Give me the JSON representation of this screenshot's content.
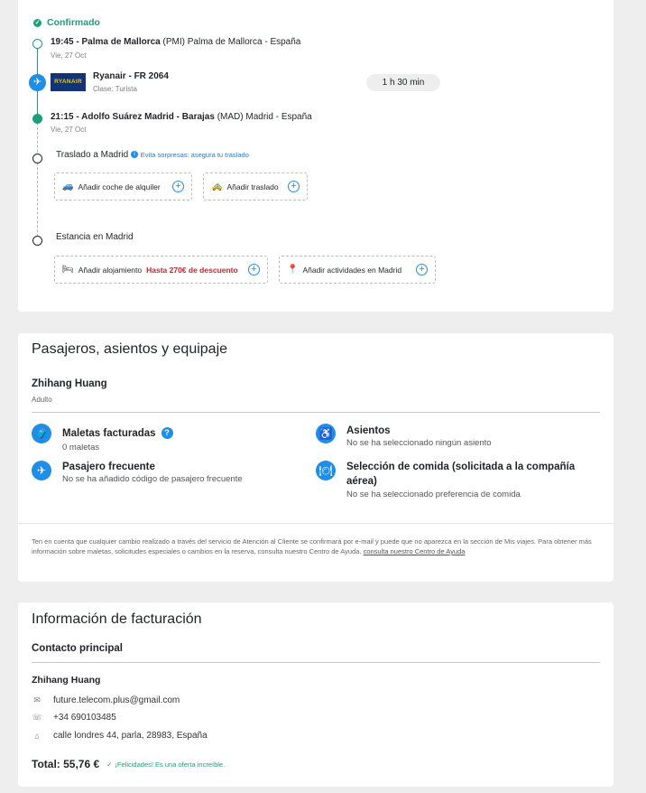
{
  "flight": {
    "status": "Confirmado",
    "departure": {
      "time": "19:45",
      "airport": "Palma de Mallorca",
      "code": "(PMI)",
      "city": "Palma de Mallorca - España",
      "date": "Vie, 27 Oct"
    },
    "airline_logo": "RYANAIR",
    "airline": "Ryanair - FR 2064",
    "class": "Clase: Turista",
    "duration": "1 h 30 min",
    "arrival": {
      "time": "21:15",
      "airport": "Adolfo Suárez Madrid - Barajas",
      "code": "(MAD)",
      "city": "Madrid - España",
      "date": "Vie, 27 Oct"
    },
    "transfer": {
      "title": "Traslado a Madrid",
      "hint": "Evita sorpresas: asegura tu traslado",
      "car": "Añadir coche de alquiler",
      "shuttle": "Añadir traslado"
    },
    "stay": {
      "title": "Estancia en Madrid",
      "lodging": "Añadir alojamiento",
      "discount": "Hasta 270€ de descuento",
      "activities": "Añadir actividades en Madrid"
    }
  },
  "passengers": {
    "heading": "Pasajeros, asientos y equipaje",
    "name": "Zhihang Huang",
    "type": "Adulto",
    "bags_title": "Maletas facturadas",
    "bags_value": "0 maletas",
    "seats_title": "Asientos",
    "seats_value": "No se ha seleccionado ningún asiento",
    "frequent_title": "Pasajero frecuente",
    "frequent_value": "No se ha añadido código de pasajero frecuente",
    "meal_title": "Selección de comida (solicitada a la compañía aérea)",
    "meal_value": "No se ha seleccionado preferencia de comida",
    "note": "Ten en cuenta que cualquier cambio realizado a través del servicio de Atención al Cliente se confirmará por e-mail y puede que no aparezca en la sección de Mis viajes. Para obtener más información sobre maletas, solicitudes especiales o cambios en la reserva, consulta nuestro Centro de Ayuda.",
    "note_link": "consulta nuestro Centro de Ayuda"
  },
  "billing": {
    "heading": "Información de facturación",
    "subheading": "Contacto principal",
    "name": "Zhihang Huang",
    "email": "future.telecom.plus@gmail.com",
    "phone": "+34 690103485",
    "address": "calle londres 44, parla, 28983, España",
    "total_label": "Total: 55,76 €",
    "deal": "¡Felicidades! Es una oferta increíble."
  },
  "icons": [
    "check-icon",
    "plane-icon",
    "car-icon",
    "taxi-icon",
    "bed-icon",
    "pin-icon",
    "plus-icon",
    "suitcase-icon",
    "seat-icon",
    "plane-icon",
    "meal-icon",
    "mail-icon",
    "phone-icon",
    "home-icon"
  ],
  "colors": {
    "accent": "#1f8ee8",
    "success": "#1b9f7a",
    "discount": "#c3262e"
  }
}
